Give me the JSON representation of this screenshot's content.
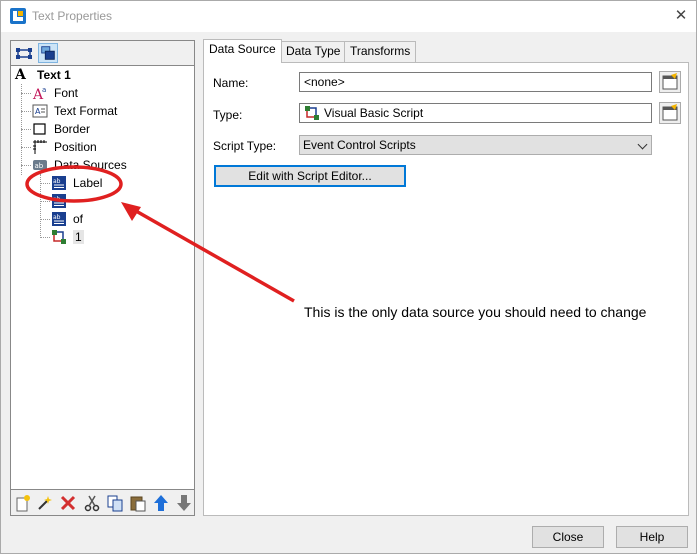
{
  "window": {
    "title": "Text Properties"
  },
  "tree": {
    "root": "Text 1",
    "items": [
      "Font",
      "Text Format",
      "Border",
      "Position",
      "Data Sources"
    ],
    "data_sources": [
      "Label",
      "",
      "of",
      "1"
    ]
  },
  "tabs": [
    "Data Source",
    "Data Type",
    "Transforms"
  ],
  "form": {
    "name_label": "Name:",
    "name_value": "<none>",
    "type_label": "Type:",
    "type_value": "Visual Basic Script",
    "script_type_label": "Script Type:",
    "script_type_value": "Event Control Scripts",
    "edit_button": "Edit with Script Editor..."
  },
  "annotation": {
    "text": "This is the only data source you should need to change"
  },
  "buttons": {
    "close": "Close",
    "help": "Help"
  },
  "colors": {
    "annotation": "#e02020",
    "accent": "#0078d7"
  }
}
